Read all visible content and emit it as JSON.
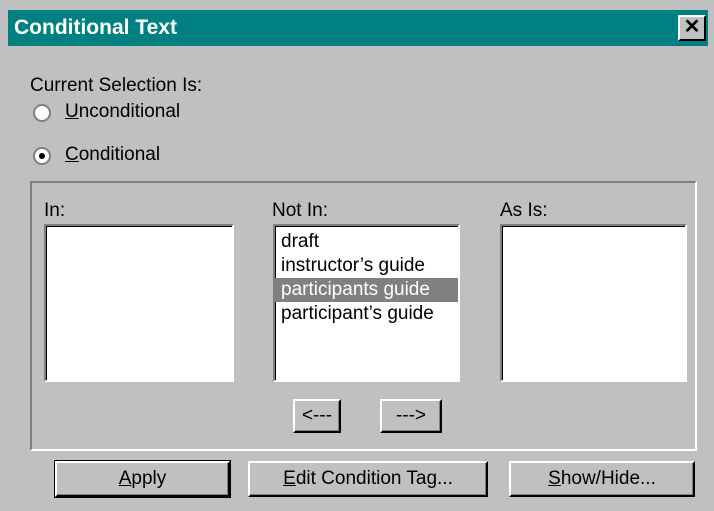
{
  "window": {
    "title": "Conditional Text",
    "close_glyph": "✕"
  },
  "selection": {
    "label": "Current Selection Is:",
    "unconditional_accel": "U",
    "unconditional_rest": "nconditional",
    "conditional_accel": "C",
    "conditional_rest": "onditional",
    "selected": "Conditional"
  },
  "lists": {
    "in_label": "In:",
    "not_in_label": "Not In:",
    "as_is_label": "As Is:",
    "in_items": [],
    "not_in_items": [
      "draft",
      "instructor’s guide",
      "participants guide",
      "participant’s guide"
    ],
    "not_in_selected_index": 2,
    "as_is_items": []
  },
  "move_buttons": {
    "left": "<---",
    "right": "--->"
  },
  "buttons": {
    "apply_accel": "A",
    "apply_rest": "pply",
    "edit_accel": "E",
    "edit_rest": "dit Condition Tag...",
    "show_accel": "S",
    "show_rest": "how/Hide..."
  },
  "colors": {
    "title_bar": "#008080",
    "dialog_face": "#c0c0c0",
    "selection_highlight": "#808080"
  }
}
